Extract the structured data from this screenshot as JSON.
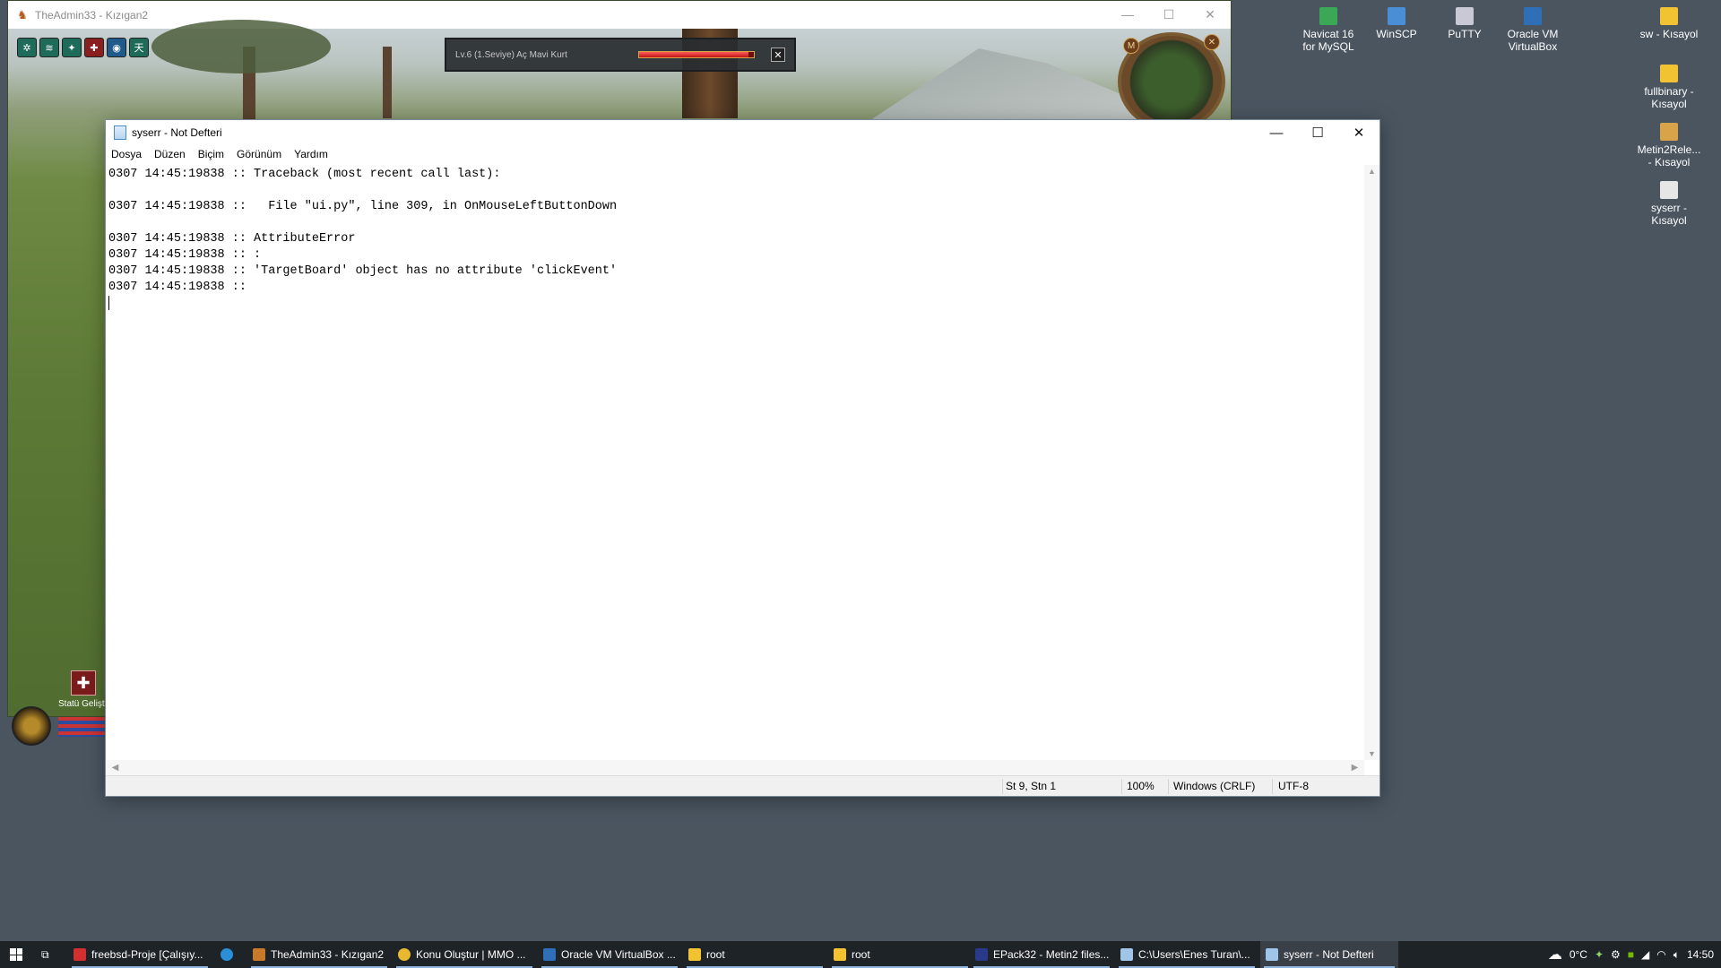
{
  "game_window": {
    "title": "TheAdmin33 - Kızıgan2",
    "skills": [
      "✲",
      "≋",
      "✦",
      "✚",
      "◉",
      "天"
    ],
    "target": {
      "name": "Lv.6 (1.Seviye) Aç Mavi Kurt",
      "hp_fraction": 0.95
    },
    "status_label": "Statü Gelişti"
  },
  "notepad": {
    "title": "syserr - Not Defteri",
    "controls": {
      "minimize": "—",
      "maximize": "☐",
      "close": "✕"
    },
    "menu": [
      "Dosya",
      "Düzen",
      "Biçim",
      "Görünüm",
      "Yardım"
    ],
    "lines": [
      "0307 14:45:19838 :: Traceback (most recent call last):",
      "",
      "0307 14:45:19838 ::   File \"ui.py\", line 309, in OnMouseLeftButtonDown",
      "",
      "0307 14:45:19838 :: AttributeError",
      "0307 14:45:19838 :: :",
      "0307 14:45:19838 :: 'TargetBoard' object has no attribute 'clickEvent'",
      "0307 14:45:19838 ::"
    ],
    "status": {
      "position": "St 9, Stn 1",
      "zoom": "100%",
      "line_ending": "Windows (CRLF)",
      "encoding": "UTF-8"
    }
  },
  "desktop_icons": [
    {
      "label_line1": "Navicat 16",
      "label_line2": "for MySQL",
      "icon": "navicat-icon",
      "color": "#3aa855"
    },
    {
      "label_line1": "WinSCP",
      "label_line2": "",
      "icon": "winscp-icon",
      "color": "#4a8fd6"
    },
    {
      "label_line1": "PuTTY",
      "label_line2": "",
      "icon": "putty-icon",
      "color": "#c9c9d6"
    },
    {
      "label_line1": "Oracle VM",
      "label_line2": "VirtualBox",
      "icon": "virtualbox-icon",
      "color": "#2f6fb8"
    },
    {
      "label_line1": "sw - Kısayol",
      "label_line2": "",
      "icon": "folder-shortcut-icon",
      "color": "#f1c232"
    },
    {
      "label_line1": "fullbinary -",
      "label_line2": "Kısayol",
      "icon": "folder-shortcut-icon",
      "color": "#f1c232"
    },
    {
      "label_line1": "Metin2Rele...",
      "label_line2": "- Kısayol",
      "icon": "app-shortcut-icon",
      "color": "#d9a34a"
    },
    {
      "label_line1": "syserr -",
      "label_line2": "Kısayol",
      "icon": "file-shortcut-icon",
      "color": "#e6e6e6"
    }
  ],
  "taskbar": {
    "items": [
      {
        "label": "freebsd-Proje [Çalışıy...",
        "icon": "freebsd-icon",
        "color": "#d23030"
      },
      {
        "label": "",
        "icon": "edge-icon",
        "color": "#2a8fd6"
      },
      {
        "label": "TheAdmin33 - Kızıgan2",
        "icon": "metin2-icon",
        "color": "#c77a2a"
      },
      {
        "label": "Konu Oluştur | MMO ...",
        "icon": "chrome-icon",
        "color": "#e8b830"
      },
      {
        "label": "Oracle VM VirtualBox ...",
        "icon": "virtualbox-icon",
        "color": "#2f6fb8"
      },
      {
        "label": "root",
        "icon": "folder-icon",
        "color": "#f1c232"
      },
      {
        "label": "root",
        "icon": "folder-icon",
        "color": "#f1c232"
      },
      {
        "label": "EPack32 - Metin2 files...",
        "icon": "console-icon",
        "color": "#2a3a8a"
      },
      {
        "label": "C:\\Users\\Enes Turan\\...",
        "icon": "notepad-icon",
        "color": "#9fc5e8"
      },
      {
        "label": "syserr - Not Defteri",
        "icon": "notepad-icon",
        "color": "#9fc5e8"
      }
    ],
    "tray": {
      "weather": "0°C",
      "time": "14:50"
    }
  }
}
